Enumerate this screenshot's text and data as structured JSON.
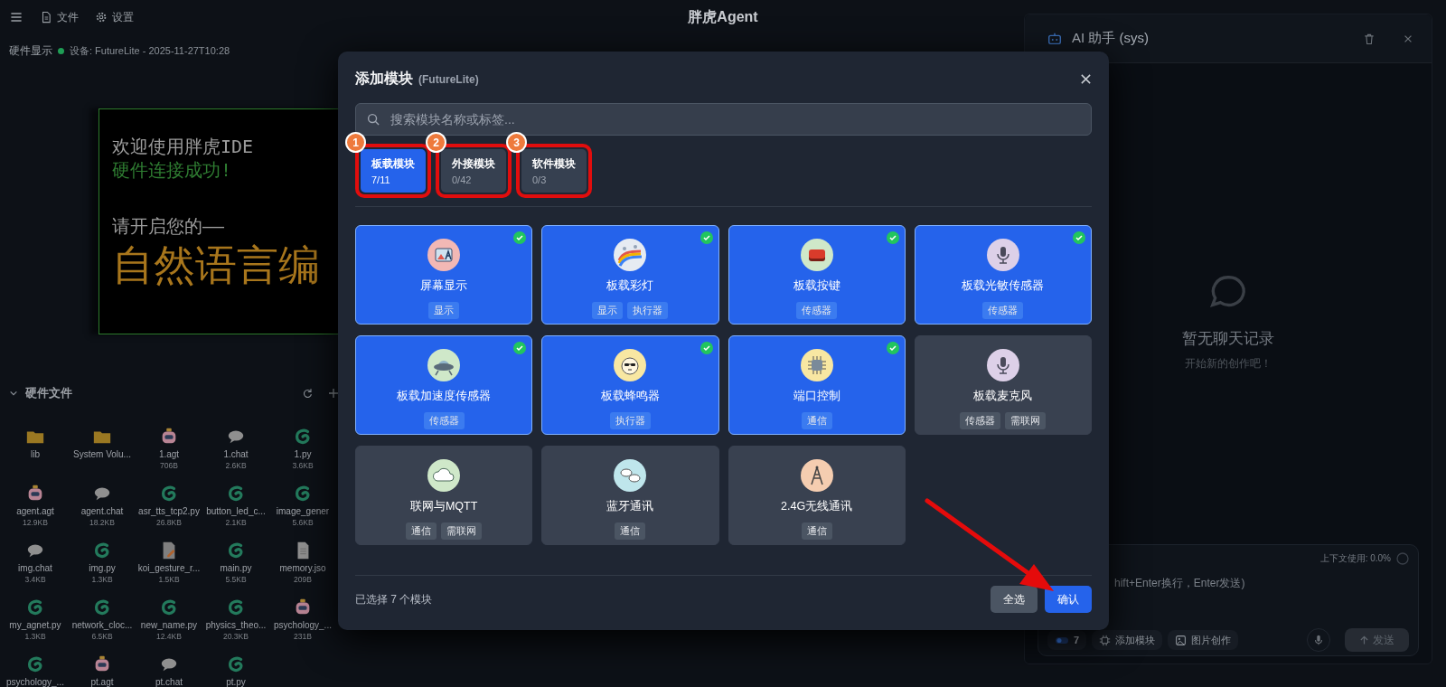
{
  "toolbar": {
    "title": "胖虎Agent",
    "menu": [
      {
        "label": "文件"
      },
      {
        "label": "设置"
      }
    ]
  },
  "device_bar": {
    "label": "硬件显示",
    "status": "设备: FutureLite - 2025-11-27T10:28",
    "connected": true
  },
  "display_preview": {
    "lines": [
      {
        "text": "欢迎使用胖虎IDE",
        "kind": "normal"
      },
      {
        "text": "硬件连接成功!",
        "kind": "success"
      },
      {
        "text": "请开启您的——",
        "kind": "normal"
      },
      {
        "text": "自然语言编",
        "kind": "headline"
      }
    ]
  },
  "files": {
    "title": "硬件文件",
    "expanded": true,
    "items": [
      {
        "name": "lib",
        "kind": "folder"
      },
      {
        "name": "System Volu...",
        "kind": "folder"
      },
      {
        "name": "1.agt",
        "size": "706B",
        "kind": "agent"
      },
      {
        "name": "1.chat",
        "size": "2.6KB",
        "kind": "chat"
      },
      {
        "name": "1.py",
        "size": "3.6KB",
        "kind": "python"
      },
      {
        "name": "agent.agt",
        "size": "12.9KB",
        "kind": "agent"
      },
      {
        "name": "agent.chat",
        "size": "18.2KB",
        "kind": "chat"
      },
      {
        "name": "asr_tts_tcp2.py",
        "size": "26.8KB",
        "kind": "python"
      },
      {
        "name": "button_led_c...",
        "size": "2.1KB",
        "kind": "python"
      },
      {
        "name": "image_gener",
        "size": "5.6KB",
        "kind": "python"
      },
      {
        "name": "img.chat",
        "size": "3.4KB",
        "kind": "chat"
      },
      {
        "name": "img.py",
        "size": "1.3KB",
        "kind": "python"
      },
      {
        "name": "koi_gesture_r...",
        "size": "1.5KB",
        "kind": "script"
      },
      {
        "name": "main.py",
        "size": "5.5KB",
        "kind": "python"
      },
      {
        "name": "memory.jso",
        "size": "209B",
        "kind": "document"
      },
      {
        "name": "my_agnet.py",
        "size": "1.3KB",
        "kind": "python"
      },
      {
        "name": "network_cloc...",
        "size": "6.5KB",
        "kind": "python"
      },
      {
        "name": "new_name.py",
        "size": "12.4KB",
        "kind": "python"
      },
      {
        "name": "physics_theo...",
        "size": "20.3KB",
        "kind": "python"
      },
      {
        "name": "psychology_...",
        "size": "231B",
        "kind": "agent"
      },
      {
        "name": "psychology_...",
        "kind": "python"
      },
      {
        "name": "pt.agt",
        "kind": "agent"
      },
      {
        "name": "pt.chat",
        "kind": "chat"
      },
      {
        "name": "pt.py",
        "kind": "python"
      }
    ]
  },
  "assistant": {
    "title": "AI 助手 (sys)",
    "empty_title": "暂无聊天记录",
    "empty_subtitle": "开始新的创作吧！",
    "context_usage": "上下文使用: 0.0%",
    "placeholder": "hift+Enter换行，Enter发送)",
    "module_count": "7",
    "modules_enabled": true,
    "actions": [
      {
        "label": "添加模块",
        "kind": "modules"
      },
      {
        "label": "图片创作",
        "kind": "image"
      }
    ],
    "send": {
      "label": "发送",
      "disabled": true
    }
  },
  "modal": {
    "title": "添加模块",
    "subtitle": "(FutureLite)",
    "search": {
      "placeholder": "搜索模块名称或标签..."
    },
    "tabs": [
      {
        "label": "板载模块",
        "count": "7/11",
        "selected": true,
        "callout": "1"
      },
      {
        "label": "外接模块",
        "count": "0/42",
        "selected": false,
        "callout": "2"
      },
      {
        "label": "软件模块",
        "count": "0/3",
        "selected": false,
        "callout": "3"
      }
    ],
    "modules": [
      {
        "name": "屏幕显示",
        "tags": [
          "显示"
        ],
        "selected": true
      },
      {
        "name": "板载彩灯",
        "tags": [
          "显示",
          "执行器"
        ],
        "selected": true
      },
      {
        "name": "板载按键",
        "tags": [
          "传感器"
        ],
        "selected": true
      },
      {
        "name": "板载光敏传感器",
        "tags": [
          "传感器"
        ],
        "selected": true
      },
      {
        "name": "板载加速度传感器",
        "tags": [
          "传感器"
        ],
        "selected": true
      },
      {
        "name": "板载蜂鸣器",
        "tags": [
          "执行器"
        ],
        "selected": true
      },
      {
        "name": "端口控制",
        "tags": [
          "通信"
        ],
        "selected": true
      },
      {
        "name": "板载麦克风",
        "tags": [
          "传感器",
          "需联网"
        ],
        "selected": false
      },
      {
        "name": "联网与MQTT",
        "tags": [
          "通信",
          "需联网"
        ],
        "selected": false
      },
      {
        "name": "蓝牙通讯",
        "tags": [
          "通信"
        ],
        "selected": false
      },
      {
        "name": "2.4G无线通讯",
        "tags": [
          "通信"
        ],
        "selected": false
      }
    ],
    "selection_summary": "已选择 7 个模块",
    "buttons": [
      {
        "label": "全选",
        "kind": "secondary"
      },
      {
        "label": "确认",
        "kind": "primary"
      }
    ]
  },
  "annotations": [
    {
      "kind": "arrow"
    }
  ]
}
